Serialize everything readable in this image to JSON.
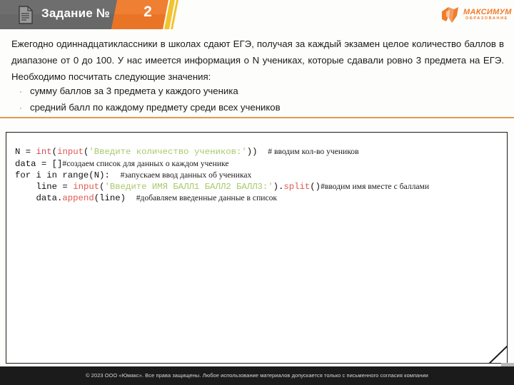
{
  "header": {
    "task_label": "Задание №",
    "task_number": "2",
    "doc_icon": "document-icon"
  },
  "logo": {
    "name": "МАКСИМУМ",
    "subtitle": "ОБРАЗОВАНИЕ",
    "color": "#f07c2a"
  },
  "intro": {
    "paragraph": "Ежегодно одиннадцатиклассники в школах сдают ЕГЭ, получая за каждый экзамен целое количество баллов в диапазоне от 0 до 100. У нас имеется информация о N учениках, которые сдавали ровно 3 предмета на ЕГЭ. Необходимо посчитать следующие значения:"
  },
  "bullets": {
    "marker": "·",
    "items": [
      "сумму баллов за 3 предмета у каждого ученика",
      "средний балл по каждому предмету среди всех учеников"
    ]
  },
  "code": {
    "language": "python",
    "lines": [
      {
        "tokens": [
          {
            "t": "N = ",
            "c": "pn"
          },
          {
            "t": "int",
            "c": "kw"
          },
          {
            "t": "(",
            "c": "pn"
          },
          {
            "t": "input",
            "c": "fn"
          },
          {
            "t": "(",
            "c": "pn"
          },
          {
            "t": "'Введите количество учеников:'",
            "c": "str"
          },
          {
            "t": "))  ",
            "c": "pn"
          },
          {
            "t": "# вводим кол-во учеников",
            "c": "cmt"
          }
        ]
      },
      {
        "tokens": [
          {
            "t": "data = []",
            "c": "pn"
          },
          {
            "t": "#создаем список для данных о каждом ученике",
            "c": "cmt"
          }
        ]
      },
      {
        "tokens": [
          {
            "t": "for i in range(N):  ",
            "c": "pn"
          },
          {
            "t": "#запускаем ввод данных об учениках",
            "c": "cmt"
          }
        ]
      },
      {
        "tokens": [
          {
            "t": "    line = ",
            "c": "pn"
          },
          {
            "t": "input",
            "c": "fn"
          },
          {
            "t": "(",
            "c": "pn"
          },
          {
            "t": "'Введите ИМЯ БАЛЛ1 БАЛЛ2 БАЛЛ3:'",
            "c": "str"
          },
          {
            "t": ").",
            "c": "pn"
          },
          {
            "t": "split",
            "c": "fn"
          },
          {
            "t": "()",
            "c": "pn"
          },
          {
            "t": "#вводим имя вместе с баллами",
            "c": "cmt"
          }
        ]
      },
      {
        "tokens": [
          {
            "t": "    data.",
            "c": "pn"
          },
          {
            "t": "append",
            "c": "fn"
          },
          {
            "t": "(line)  ",
            "c": "pn"
          },
          {
            "t": "#добавляем введенные данные в список",
            "c": "cmt"
          }
        ]
      }
    ]
  },
  "footer": {
    "copyright": "© 2023 ООО «Юмакс». Все права защищены. Любое использование материалов допускается только с  письменного согласия компании"
  }
}
